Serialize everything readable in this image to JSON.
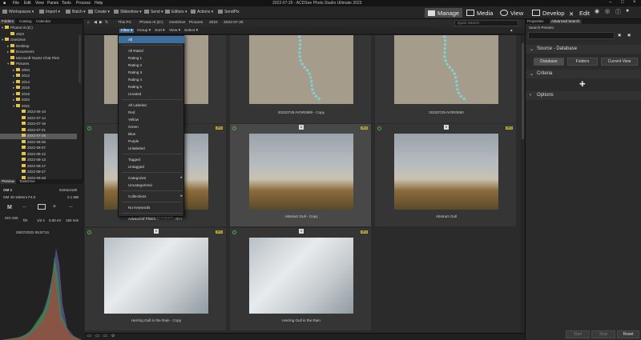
{
  "app": {
    "title": "2022-07-25 - ACDSee Photo Studio Ultimate 2023",
    "menu": [
      "File",
      "Edit",
      "View",
      "Panes",
      "Tools",
      "Process",
      "Help"
    ]
  },
  "toolbar": {
    "left": [
      "Workspaces",
      "Import",
      "Batch",
      "Create",
      "Slideshow",
      "Send",
      "Editors",
      "Actions",
      "SendPix"
    ],
    "modes": [
      "Manage",
      "Media",
      "View",
      "Develop",
      "Edit"
    ]
  },
  "leftpanel": {
    "tabs": [
      "Folders",
      "Catalog",
      "Calendar"
    ],
    "tree": [
      {
        "label": "Photos III (D:)",
        "indent": 0,
        "arrow": "▾"
      },
      {
        "label": "2022",
        "indent": 1,
        "arrow": ""
      },
      {
        "label": "OneDrive",
        "indent": 0,
        "arrow": "▾"
      },
      {
        "label": "Desktop",
        "indent": 1,
        "arrow": "▸"
      },
      {
        "label": "Documents",
        "indent": 1,
        "arrow": "▸"
      },
      {
        "label": "Microsoft Teams Chat Files",
        "indent": 1,
        "arrow": ""
      },
      {
        "label": "Pictures",
        "indent": 1,
        "arrow": "▾"
      },
      {
        "label": "2004",
        "indent": 2,
        "arrow": "▸"
      },
      {
        "label": "2012",
        "indent": 2,
        "arrow": "▸"
      },
      {
        "label": "2014",
        "indent": 2,
        "arrow": "▸"
      },
      {
        "label": "2015",
        "indent": 2,
        "arrow": "▸"
      },
      {
        "label": "2019",
        "indent": 2,
        "arrow": "▸"
      },
      {
        "label": "2020",
        "indent": 2,
        "arrow": "▸"
      },
      {
        "label": "2022",
        "indent": 2,
        "arrow": "▾"
      },
      {
        "label": "2022-06-10",
        "indent": 3,
        "arrow": ""
      },
      {
        "label": "2022-07-14",
        "indent": 3,
        "arrow": ""
      },
      {
        "label": "2022-07-16",
        "indent": 3,
        "arrow": ""
      },
      {
        "label": "2022-07-21",
        "indent": 3,
        "arrow": ""
      },
      {
        "label": "2022-07-25",
        "indent": 3,
        "arrow": "",
        "selected": true
      },
      {
        "label": "2022-08-05",
        "indent": 3,
        "arrow": ""
      },
      {
        "label": "2022-08-07",
        "indent": 3,
        "arrow": ""
      },
      {
        "label": "2022-08-12",
        "indent": 3,
        "arrow": ""
      },
      {
        "label": "2022-08-13",
        "indent": 3,
        "arrow": ""
      },
      {
        "label": "2022-08-17",
        "indent": 3,
        "arrow": ""
      },
      {
        "label": "2022-08-27",
        "indent": 3,
        "arrow": ""
      },
      {
        "label": "2022-09-28",
        "indent": 3,
        "arrow": ""
      }
    ],
    "preview_tabs": [
      "Preview",
      "TaskDrive"
    ]
  },
  "preview": {
    "camera": "OM-1",
    "dimensions": "5184x2160",
    "lens": "OM 40-150mm F4.0",
    "filesize": "2.1 MB",
    "mode": "M",
    "iso": "ISO 200",
    "fstop": "f/8",
    "shutter": "1/2 s",
    "ev": "0.00 eV",
    "focal": "150 mm",
    "date": "25/07/2022 06:57:51"
  },
  "pathbar": {
    "crumbs": [
      "This PC",
      "Photos III (D:)",
      "OneDrive",
      "Pictures",
      "2022",
      "2022-07-25"
    ],
    "search_placeholder": "Quick Search"
  },
  "filterbar": {
    "items": [
      "Filter",
      "Group",
      "Sort",
      "View",
      "Select"
    ]
  },
  "grid": {
    "items": [
      {
        "caption": "",
        "type": "ground",
        "badge": "",
        "jpg": false
      },
      {
        "caption": "20220725-IVOR0690 - Copy",
        "type": "ground",
        "badge": "",
        "jpg": false
      },
      {
        "caption": "20220725-IVOR0690",
        "type": "ground",
        "badge": "",
        "jpg": false
      },
      {
        "caption": "20220725-young gull",
        "type": "gull",
        "badge": "",
        "jpg": true
      },
      {
        "caption": "Abstract Gull - Copy",
        "type": "gull",
        "badge": "5",
        "jpg": true
      },
      {
        "caption": "Abstract Gull",
        "type": "gull",
        "badge": "5",
        "jpg": true
      },
      {
        "caption": "Herring Gull in the Rain - Copy",
        "type": "rain",
        "badge": "5",
        "jpg": true
      },
      {
        "caption": "Herring Gull in the Rain",
        "type": "rain",
        "badge": "5",
        "jpg": true
      }
    ],
    "jpg_label": "JPG"
  },
  "dropdown": {
    "items": [
      {
        "label": "All",
        "kind": "item",
        "first": true
      },
      {
        "kind": "sep"
      },
      {
        "label": "All Rated",
        "kind": "item"
      },
      {
        "label": "Rating 1",
        "kind": "item"
      },
      {
        "label": "Rating 2",
        "kind": "item"
      },
      {
        "label": "Rating 3",
        "kind": "item"
      },
      {
        "label": "Rating 4",
        "kind": "item"
      },
      {
        "label": "Rating 5",
        "kind": "item"
      },
      {
        "label": "Unrated",
        "kind": "item"
      },
      {
        "kind": "sep"
      },
      {
        "label": "All Labeled",
        "kind": "item"
      },
      {
        "label": "Red",
        "kind": "item"
      },
      {
        "label": "Yellow",
        "kind": "item"
      },
      {
        "label": "Green",
        "kind": "item"
      },
      {
        "label": "Blue",
        "kind": "item"
      },
      {
        "label": "Purple",
        "kind": "item"
      },
      {
        "label": "Unlabeled",
        "kind": "item"
      },
      {
        "kind": "sep"
      },
      {
        "label": "Tagged",
        "kind": "item"
      },
      {
        "label": "Untagged",
        "kind": "item"
      },
      {
        "kind": "sep"
      },
      {
        "label": "Categories",
        "kind": "item",
        "sub": true
      },
      {
        "label": "Uncategorized",
        "kind": "item"
      },
      {
        "kind": "sep"
      },
      {
        "label": "Collections",
        "kind": "item",
        "sub": true
      },
      {
        "kind": "sep"
      },
      {
        "label": "No Keywords",
        "kind": "item"
      },
      {
        "kind": "sep"
      },
      {
        "label": "Advanced Filters...",
        "kind": "item",
        "shortcut": "Alt+I"
      }
    ]
  },
  "rightpanel": {
    "tabs": [
      "Properties",
      "Advanced Search"
    ],
    "search_presets_label": "Search Presets:",
    "source_header": "Source - Database",
    "source_buttons": [
      "Database",
      "Folders",
      "Current View"
    ],
    "criteria_header": "Criteria",
    "options_header": "Options",
    "footer_buttons": [
      "Start",
      "Stop",
      "Reset"
    ]
  },
  "colors": {
    "accent": "#3d6e9c",
    "folder": "#e3c14a",
    "selection": "#5a5a5a",
    "ok_ring": "#4caf50"
  }
}
